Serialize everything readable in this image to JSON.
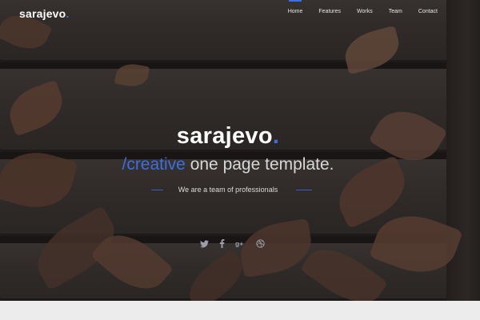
{
  "brand": {
    "name": "sarajevo",
    "dot": "."
  },
  "nav": {
    "items": [
      "Home",
      "Features",
      "Works",
      "Team",
      "Contact"
    ]
  },
  "hero": {
    "title": "sarajevo",
    "title_dot": ".",
    "subtitle_accent": "/creative",
    "subtitle_rest": " one page template.",
    "tagline": "We are a team of professionals"
  },
  "social": {
    "twitter": "twitter-icon",
    "facebook": "facebook-icon",
    "google": "google-plus-icon",
    "dribbble": "dribbble-icon"
  },
  "colors": {
    "accent": "#3d6fe0",
    "text": "#ffffff"
  }
}
